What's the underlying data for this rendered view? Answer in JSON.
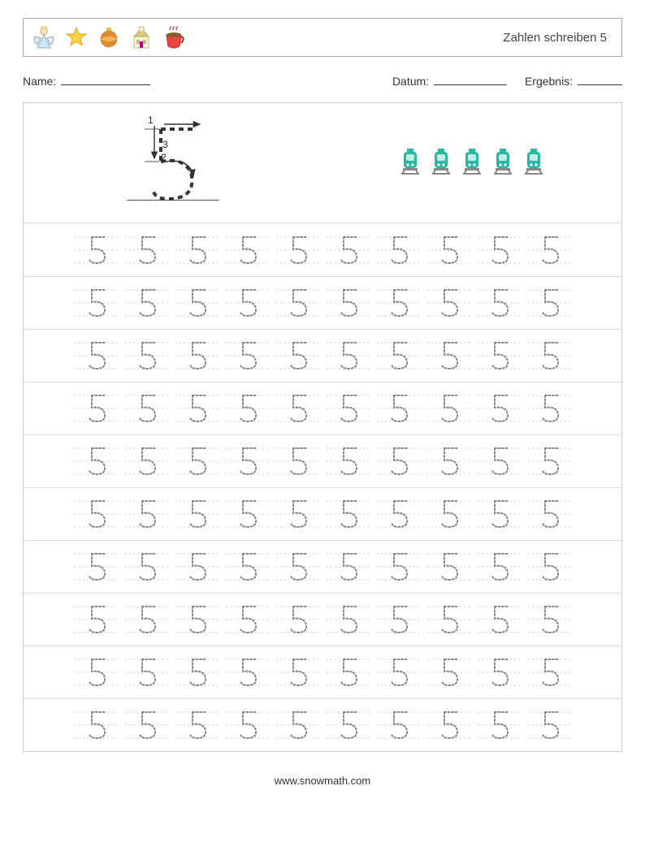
{
  "header": {
    "title": "Zahlen schreiben 5",
    "icons": [
      "angel-icon",
      "star-icon",
      "ornament-icon",
      "church-icon",
      "cocoa-icon"
    ]
  },
  "meta": {
    "name_label": "Name:",
    "date_label": "Datum:",
    "result_label": "Ergebnis:"
  },
  "stroke": {
    "step1": "1",
    "step2": "2",
    "step3": "3",
    "digit": "5"
  },
  "count_icons": {
    "name": "train-icon",
    "quantity": 5
  },
  "practice": {
    "digit": "5",
    "rows": 10,
    "cols": 10
  },
  "footer": "www.snowmath.com"
}
